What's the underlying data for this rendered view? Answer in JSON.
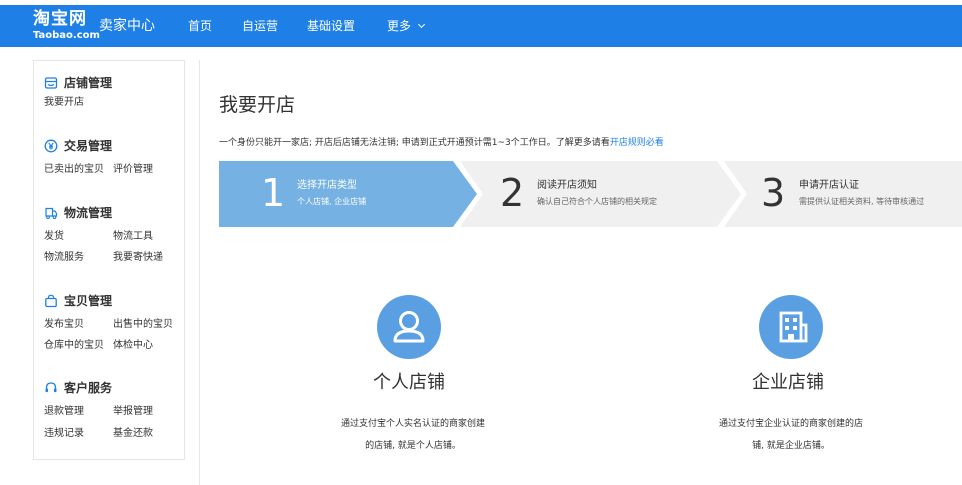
{
  "header": {
    "logo_cn": "淘宝网",
    "logo_en": "Taobao.com",
    "seller_center": "卖家中心",
    "nav": [
      "首页",
      "自运营",
      "基础设置",
      "更多"
    ]
  },
  "sidebar": {
    "sections": [
      {
        "title": "店铺管理",
        "icon": "store-icon",
        "links": [
          "我要开店"
        ]
      },
      {
        "title": "交易管理",
        "icon": "yuan-icon",
        "links": [
          "已卖出的宝贝",
          "评价管理"
        ]
      },
      {
        "title": "物流管理",
        "icon": "delivery-icon",
        "links": [
          "发货",
          "物流工具",
          "物流服务",
          "我要寄快递"
        ]
      },
      {
        "title": "宝贝管理",
        "icon": "bag-icon",
        "links": [
          "发布宝贝",
          "出售中的宝贝",
          "仓库中的宝贝",
          "体检中心"
        ]
      },
      {
        "title": "客户服务",
        "icon": "headset-icon",
        "links": [
          "退款管理",
          "举报管理",
          "违规记录",
          "基金还款"
        ]
      }
    ]
  },
  "main": {
    "title": "我要开店",
    "notice": "一个身份只能开一家店; 开店后店铺无法注销; 申请到正式开通预计需1~3个工作日。了解更多请看",
    "notice_link": "开店规则必看",
    "steps": [
      {
        "num": "1",
        "title": "选择开店类型",
        "sub": "个人店铺, 企业店铺"
      },
      {
        "num": "2",
        "title": "阅读开店须知",
        "sub": "确认自己符合个人店铺的相关规定"
      },
      {
        "num": "3",
        "title": "申请开店认证",
        "sub": "需提供认证相关资料, 等待审核通过"
      }
    ],
    "cards": [
      {
        "title": "个人店铺",
        "icon": "person-icon",
        "desc1": "通过支付宝个人实名认证的商家创建",
        "desc2": "的店铺, 就是个人店铺。"
      },
      {
        "title": "企业店铺",
        "icon": "building-icon",
        "desc1": "通过支付宝企业认证的商家创建的店",
        "desc2": "铺, 就是企业店铺。"
      }
    ]
  },
  "colors": {
    "header_bg": "#1e80e6",
    "step_active_bg": "#75b1e3",
    "step_inactive_bg": "#f0f0f0",
    "icon_circle": "#5b9fe3",
    "link": "#1e80e6"
  }
}
